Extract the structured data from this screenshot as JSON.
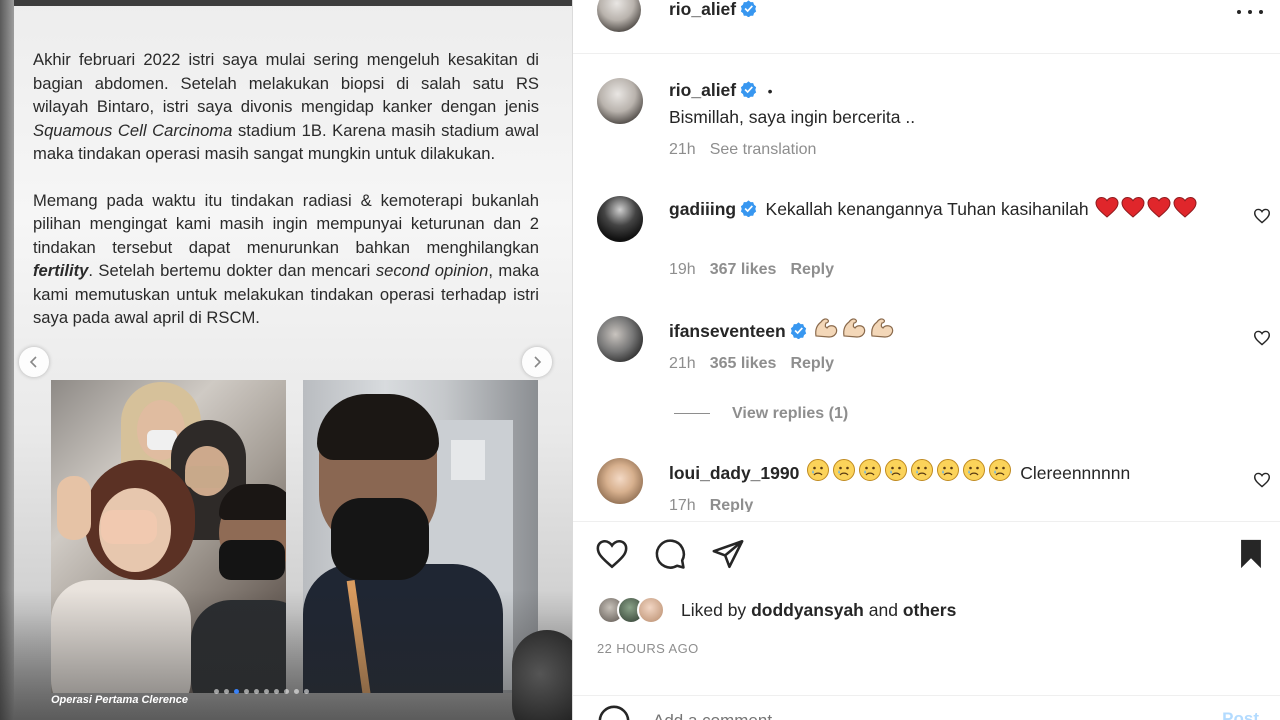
{
  "post": {
    "story": {
      "p1_a": "Akhir februari 2022 istri saya mulai sering mengeluh kesakitan di bagian abdomen. Setelah melakukan biopsi di salah satu RS wilayah Bintaro, istri saya divonis mengidap kanker dengan jenis ",
      "p1_em": "Squamous Cell Carcinoma",
      "p1_b": " stadium 1B. Karena masih stadium awal maka tindakan operasi masih sangat mungkin untuk dilakukan.",
      "p2_a": "Memang pada waktu itu tindakan radiasi & kemoterapi bukanlah pilihan mengingat kami masih ingin mempunyai keturunan dan 2 tindakan tersebut dapat menurunkan bahkan menghilangkan ",
      "p2_strong": "fertility",
      "p2_b": ". Setelah bertemu dokter dan mencari ",
      "p2_em": "second opinion",
      "p2_c": ", maka kami memutuskan untuk melakukan tindakan operasi terhadap istri saya pada awal april di RSCM."
    },
    "caption": "Operasi Pertama Clerence",
    "carousel": {
      "total": 10,
      "active": 2
    }
  },
  "header": {
    "username": "rio_alief"
  },
  "caption_comment": {
    "username": "rio_alief",
    "dot": "•",
    "text": "Bismillah, saya ingin bercerita ..",
    "time": "21h",
    "translate": "See translation"
  },
  "comments": [
    {
      "username": "gadiiing",
      "text": "Kekallah kenangannya Tuhan kasihanilah",
      "emoji": "red-heart",
      "emoji_count": 4,
      "time": "19h",
      "likes": "367 likes",
      "reply": "Reply"
    },
    {
      "username": "ifanseventeen",
      "text": "",
      "emoji": "flexed-biceps",
      "emoji_count": 3,
      "time": "21h",
      "likes": "365 likes",
      "reply": "Reply",
      "view_replies": "View replies (1)"
    },
    {
      "username": "loui_dady_1990",
      "text": "Clereennnnnn",
      "emoji": "crying-face",
      "emoji_count": 8,
      "time": "17h",
      "reply": "Reply"
    }
  ],
  "liked_by": {
    "prefix": "Liked by",
    "user": "doddyansyah",
    "mid": "and",
    "others": "others"
  },
  "timestamp": "22 HOURS AGO",
  "add_comment": {
    "placeholder": "Add a comment...",
    "post": "Post"
  },
  "colors": {
    "verified": "#3897f0",
    "heart": "#ed4956",
    "link_blue": "#0095f6",
    "meta": "#8e8e8e"
  }
}
